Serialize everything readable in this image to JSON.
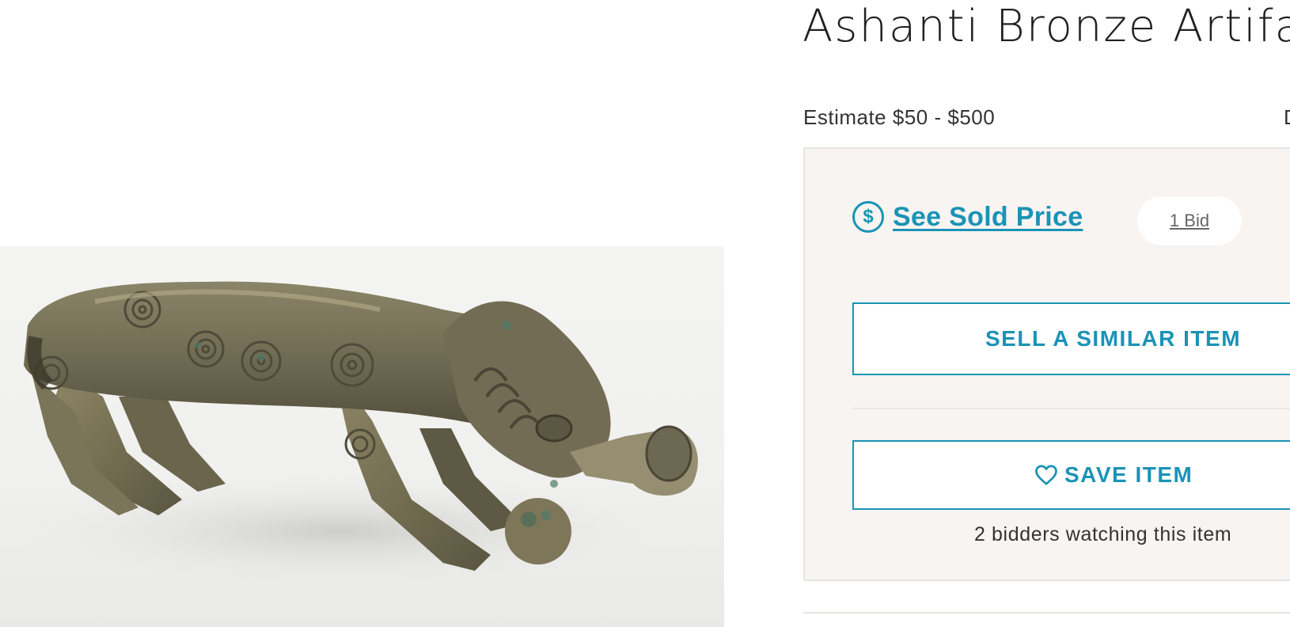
{
  "item": {
    "title": "Ashanti Bronze Artifact",
    "estimate": "Estimate $50 - $500",
    "estimate_clipped_char": "D"
  },
  "bid_panel": {
    "dollar_icon": "$",
    "see_sold_price": "See Sold Price",
    "bid_count": "1 Bid",
    "sell_similar": "SELL A SIMILAR ITEM",
    "save_item": "SAVE ITEM",
    "watchers": "2 bidders watching this item"
  },
  "icons": {
    "sold_price": "dollar-circle-icon",
    "save": "heart-icon"
  },
  "colors": {
    "accent": "#1a93b6",
    "panel_bg": "#f8f4f1",
    "title": "#231f20"
  }
}
